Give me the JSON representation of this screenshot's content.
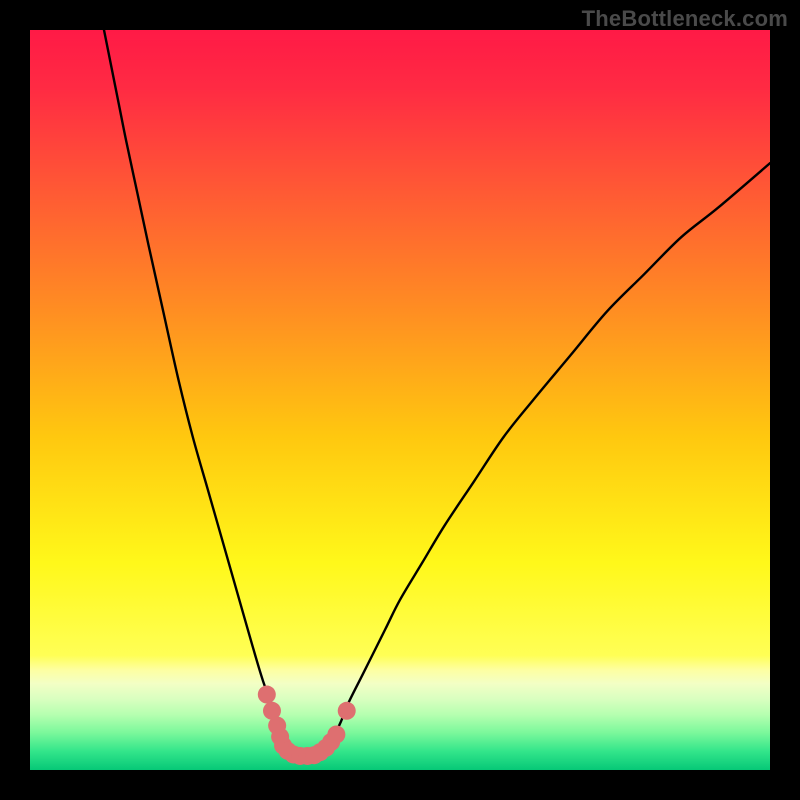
{
  "watermark": "TheBottleneck.com",
  "chart_data": {
    "type": "line",
    "title": "",
    "xlabel": "",
    "ylabel": "",
    "xlim": [
      0,
      100
    ],
    "ylim": [
      0,
      100
    ],
    "background_gradient": {
      "stops": [
        {
          "offset": 0.0,
          "color": "#ff1a46"
        },
        {
          "offset": 0.08,
          "color": "#ff2b43"
        },
        {
          "offset": 0.22,
          "color": "#ff5a34"
        },
        {
          "offset": 0.38,
          "color": "#ff8e22"
        },
        {
          "offset": 0.55,
          "color": "#ffc80f"
        },
        {
          "offset": 0.72,
          "color": "#fff81a"
        },
        {
          "offset": 0.845,
          "color": "#ffff55"
        },
        {
          "offset": 0.865,
          "color": "#fdffa2"
        },
        {
          "offset": 0.883,
          "color": "#f3ffc5"
        },
        {
          "offset": 0.904,
          "color": "#d9ffc0"
        },
        {
          "offset": 0.925,
          "color": "#b6ffb0"
        },
        {
          "offset": 0.95,
          "color": "#7af89b"
        },
        {
          "offset": 0.975,
          "color": "#32e58a"
        },
        {
          "offset": 1.0,
          "color": "#06c877"
        }
      ]
    },
    "series": [
      {
        "name": "bottleneck-curve",
        "stroke": "#000000",
        "stroke_width": 2.4,
        "x": [
          10,
          11,
          12,
          13,
          14.5,
          16,
          18,
          20,
          22,
          24,
          26,
          28,
          30,
          31.5,
          33,
          33.7,
          34.2,
          35,
          36,
          37,
          38,
          39,
          40,
          41,
          42,
          43,
          45,
          48,
          50,
          53,
          56,
          60,
          64,
          68,
          73,
          78,
          83,
          88,
          93,
          100
        ],
        "y": [
          100,
          95,
          90,
          85,
          78,
          71,
          62,
          53,
          45,
          38,
          31,
          24,
          17,
          12,
          8,
          5.5,
          4,
          3,
          2.2,
          2,
          2,
          2.2,
          3,
          4.5,
          6.5,
          9,
          13,
          19,
          23,
          28,
          33,
          39,
          45,
          50,
          56,
          62,
          67,
          72,
          76,
          82
        ]
      }
    ],
    "marker_groups": [
      {
        "name": "near-minimum-markers",
        "color": "#de6f70",
        "radius": 9,
        "points": [
          {
            "x": 32.0,
            "y": 10.2
          },
          {
            "x": 32.7,
            "y": 8.0
          },
          {
            "x": 33.4,
            "y": 6.0
          },
          {
            "x": 33.8,
            "y": 4.5
          },
          {
            "x": 34.2,
            "y": 3.3
          },
          {
            "x": 34.8,
            "y": 2.6
          },
          {
            "x": 35.6,
            "y": 2.1
          },
          {
            "x": 36.5,
            "y": 1.9
          },
          {
            "x": 37.5,
            "y": 1.9
          },
          {
            "x": 38.4,
            "y": 2.0
          },
          {
            "x": 39.2,
            "y": 2.4
          },
          {
            "x": 40.0,
            "y": 3.0
          },
          {
            "x": 40.7,
            "y": 3.8
          },
          {
            "x": 41.4,
            "y": 4.8
          },
          {
            "x": 42.8,
            "y": 8.0
          }
        ]
      }
    ]
  }
}
